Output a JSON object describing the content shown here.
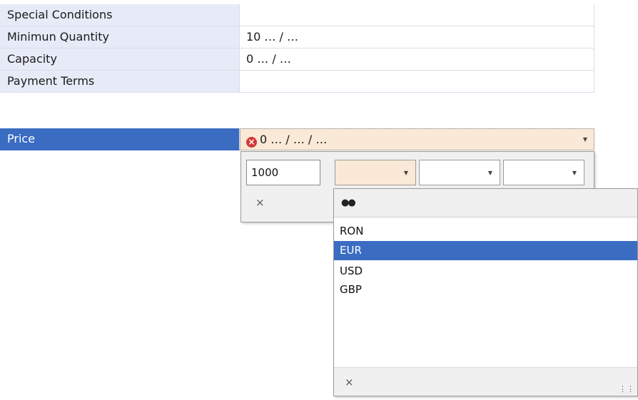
{
  "grid": {
    "rows": [
      {
        "label": "Special Conditions",
        "value": ""
      },
      {
        "label": "Minimun Quantity",
        "value": "10 … / …"
      },
      {
        "label": "Capacity",
        "value": "0 … / …"
      },
      {
        "label": "Payment Terms",
        "value": ""
      },
      {
        "label": "Price",
        "value": "0 … / … / …",
        "selected": true,
        "has_error": true,
        "error_icon": "error-icon",
        "dropdown_icon": "chevron-down-icon"
      }
    ]
  },
  "price_editor": {
    "amount_value": "1000",
    "combo1_value": "",
    "combo2_value": "",
    "combo3_value": "",
    "clear_label": "×"
  },
  "currency_dropdown": {
    "search_icon": "binoculars-icon",
    "items": [
      {
        "label": "RON",
        "selected": false
      },
      {
        "label": "EUR",
        "selected": true
      },
      {
        "label": "USD",
        "selected": false
      },
      {
        "label": "GBP",
        "selected": false
      }
    ],
    "clear_label": "×",
    "resize_grip_icon": "resize-grip-icon"
  },
  "colors": {
    "selection": "#3a6cc2",
    "label_bg": "#e6ebf7",
    "editing_bg": "#f9e9d6",
    "error": "#d23a3a"
  }
}
